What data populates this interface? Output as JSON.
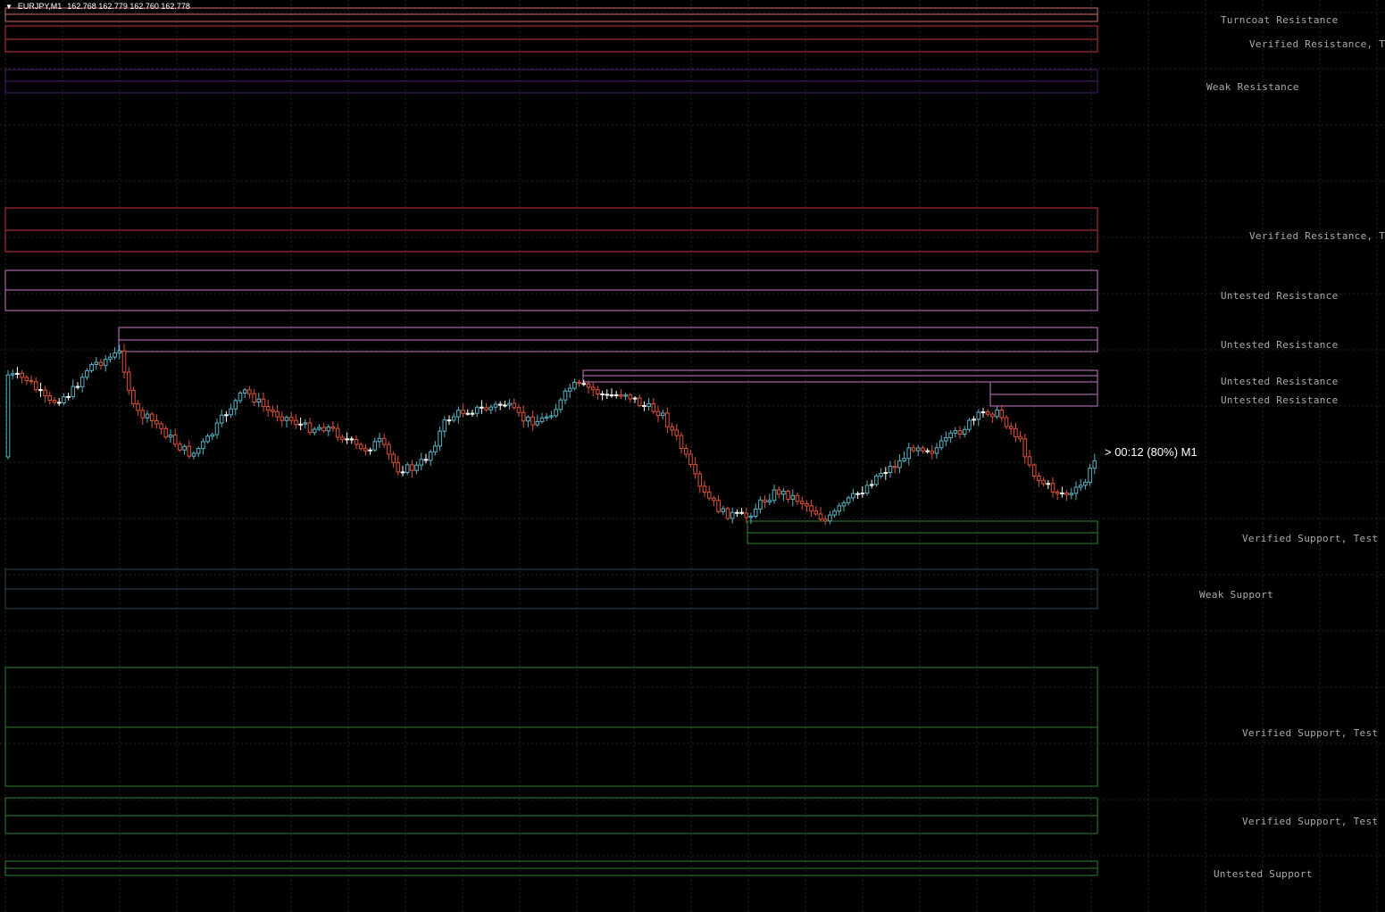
{
  "header": {
    "symbol": "EURJPY,M1",
    "quote": "162.768 162.779 162.760 162.778"
  },
  "timer": "> 00:12 (80%) M1",
  "zones": [
    {
      "label": "Turncoat Resistance",
      "type": "turncoat"
    },
    {
      "label": "Verified Resistance, T",
      "type": "verified-res"
    },
    {
      "label": "Weak Resistance",
      "type": "weak-res"
    },
    {
      "label": "Verified Resistance, T",
      "type": "verified-res"
    },
    {
      "label": "Untested Resistance",
      "type": "untested-res"
    },
    {
      "label": "Untested Resistance",
      "type": "untested-res"
    },
    {
      "label": "Untested Resistance",
      "type": "untested-res"
    },
    {
      "label": "Untested Resistance",
      "type": "untested-res"
    },
    {
      "label": "Verified Support, Test",
      "type": "verified-sup"
    },
    {
      "label": "Weak Support",
      "type": "weak-sup"
    },
    {
      "label": "Verified Support, Test",
      "type": "verified-sup"
    },
    {
      "label": "Verified Support, Test",
      "type": "verified-sup"
    },
    {
      "label": "Untested Support",
      "type": "untested-sup"
    }
  ],
  "colors": {
    "background": "#000000",
    "grid": "#1e2a2a",
    "bull": "#5ab4c4",
    "bear": "#e0533a",
    "doji": "#ffffff",
    "turncoat": "#d86e6e",
    "verified-res": "#c8323c",
    "weak-res": "#4b1e6e",
    "untested-res": "#c878c8",
    "verified-sup": "#2d8232",
    "weak-sup": "#2f4a58",
    "untested-sup": "#2d8232"
  }
}
